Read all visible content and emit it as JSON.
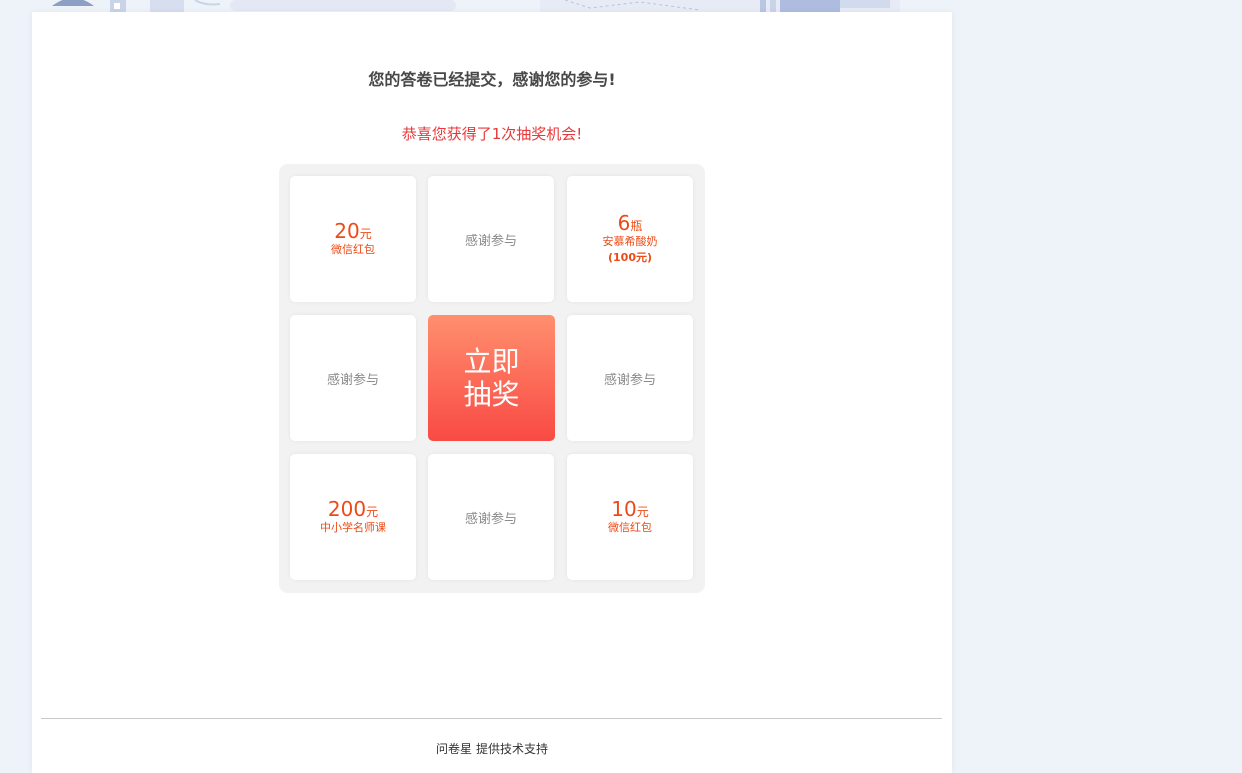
{
  "page": {
    "title": "您的答卷已经提交，感谢您的参与!",
    "congrats": "恭喜您获得了1次抽奖机会!"
  },
  "lottery": {
    "draw_button": "立即抽奖",
    "cells": [
      {
        "num": "20",
        "unit": "元",
        "desc": "微信红包"
      },
      {
        "thanks": "感谢参与"
      },
      {
        "num": "6",
        "unit": "瓶",
        "desc": "安慕希酸奶",
        "sub": "(100元)"
      },
      {
        "thanks": "感谢参与"
      },
      {
        "thanks": "感谢参与"
      },
      {
        "num": "200",
        "unit": "元",
        "desc": "中小学名师课"
      },
      {
        "thanks": "感谢参与"
      },
      {
        "num": "10",
        "unit": "元",
        "desc": "微信红包"
      }
    ]
  },
  "footer": {
    "brand": "问卷星",
    "text": "提供技术支持"
  },
  "colors": {
    "accent": "#ec4b17",
    "congrats": "#e8393a",
    "button_top": "#ff8f6e",
    "button_bottom": "#f94a44"
  }
}
